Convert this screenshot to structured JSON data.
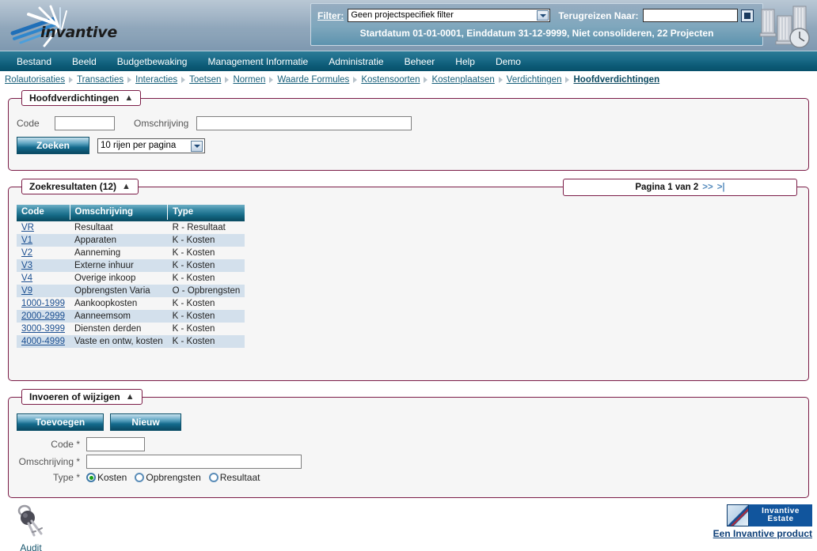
{
  "banner": {
    "logo_text": "invantive",
    "logo_icon": "invantive-rays-logo",
    "buildings_icon": "buildings-clock-graphic",
    "filter_label": "Filter:",
    "filter_value": "Geen projectspecifiek filter",
    "travel_label": "Terugreizen Naar:",
    "travel_value": "",
    "calendar_icon": "calendar-icon",
    "status_line": "Startdatum 01-01-0001, Einddatum 31-12-9999, Niet consolideren, 22 Projecten"
  },
  "menu": [
    {
      "label": "Bestand"
    },
    {
      "label": "Beeld"
    },
    {
      "label": "Budgetbewaking"
    },
    {
      "label": "Management Informatie"
    },
    {
      "label": "Administratie"
    },
    {
      "label": "Beheer"
    },
    {
      "label": "Help"
    },
    {
      "label": "Demo"
    }
  ],
  "breadcrumb": [
    {
      "label": "Rolautorisaties",
      "current": false
    },
    {
      "label": "Transacties",
      "current": false
    },
    {
      "label": "Interacties",
      "current": false
    },
    {
      "label": "Toetsen",
      "current": false
    },
    {
      "label": "Normen",
      "current": false
    },
    {
      "label": "Waarde Formules",
      "current": false
    },
    {
      "label": "Kostensoorten",
      "current": false
    },
    {
      "label": "Kostenplaatsen",
      "current": false
    },
    {
      "label": "Verdichtingen",
      "current": false
    },
    {
      "label": "Hoofdverdichtingen",
      "current": true
    }
  ],
  "search_panel": {
    "legend": "Hoofdverdichtingen",
    "collapse_icon": "collapse-chevron-icon",
    "code_label": "Code",
    "code_value": "",
    "omschrijving_label": "Omschrijving",
    "omschrijving_value": "",
    "search_button": "Zoeken",
    "rows_per_page": "10 rijen per pagina",
    "dropdown_icon": "chevron-down-icon"
  },
  "results_panel": {
    "legend": "Zoekresultaten (12)",
    "collapse_icon": "collapse-chevron-icon",
    "pagination_text": "Pagina 1 van 2",
    "next_page_icon": ">>",
    "last_page_icon": ">|",
    "columns": [
      "Code",
      "Omschrijving",
      "Type"
    ],
    "rows": [
      {
        "code": "VR",
        "omschrijving": "Resultaat",
        "type": "R - Resultaat"
      },
      {
        "code": "V1",
        "omschrijving": "Apparaten",
        "type": "K - Kosten"
      },
      {
        "code": "V2",
        "omschrijving": "Aanneming",
        "type": "K - Kosten"
      },
      {
        "code": "V3",
        "omschrijving": "Externe inhuur",
        "type": "K - Kosten"
      },
      {
        "code": "V4",
        "omschrijving": "Overige inkoop",
        "type": "K - Kosten"
      },
      {
        "code": "V9",
        "omschrijving": "Opbrengsten Varia",
        "type": "O - Opbrengsten"
      },
      {
        "code": "1000-1999",
        "omschrijving": "Aankoopkosten",
        "type": "K - Kosten"
      },
      {
        "code": "2000-2999",
        "omschrijving": "Aanneemsom",
        "type": "K - Kosten"
      },
      {
        "code": "3000-3999",
        "omschrijving": "Diensten derden",
        "type": "K - Kosten"
      },
      {
        "code": "4000-4999",
        "omschrijving": "Vaste en ontw, kosten",
        "type": "K - Kosten"
      }
    ]
  },
  "edit_panel": {
    "legend": "Invoeren of wijzigen",
    "collapse_icon": "collapse-chevron-icon",
    "add_button": "Toevoegen",
    "new_button": "Nieuw",
    "code_label": "Code *",
    "code_value": "",
    "omschrijving_label": "Omschrijving *",
    "omschrijving_value": "",
    "type_label": "Type *",
    "type_options": [
      {
        "label": "Kosten",
        "selected": true
      },
      {
        "label": "Opbrengsten",
        "selected": false
      },
      {
        "label": "Resultaat",
        "selected": false
      }
    ]
  },
  "footer": {
    "audit_icon": "keys-icon",
    "audit_label": "Audit",
    "product_icon": "invantive-estate-icon",
    "product_name_line1": "Invantive",
    "product_name_line2": "Estate",
    "product_link": "Een Invantive product"
  },
  "colors": {
    "panel_border": "#7b1c47",
    "menu_bar": "#0d5c78",
    "banner": "#8ba3b8",
    "link": "#1b4f91",
    "alt_row": "#d3e0ec"
  }
}
